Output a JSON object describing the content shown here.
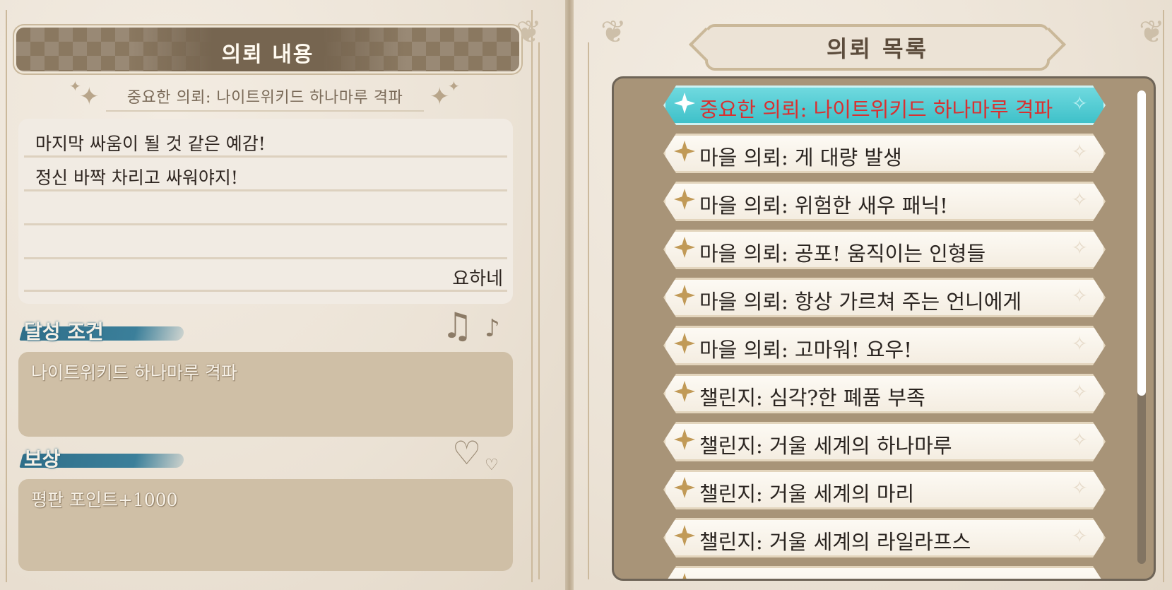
{
  "detail": {
    "title": "의뢰 내용",
    "quest_name": "중요한 의뢰: 나이트위키드 하나마루 격파",
    "message_lines": [
      "마지막 싸움이 될 것 같은 예감!",
      "정신 바짝 차리고 싸워야지!"
    ],
    "sender": "요하네",
    "condition_label": "달성 조건",
    "condition_text": "나이트위키드 하나마루 격파",
    "reward_label": "보상",
    "reward_text": "평판 포인트+1000"
  },
  "list": {
    "title": "의뢰 목록",
    "items": [
      {
        "label": "중요한 의뢰: 나이트위키드 하나마루 격파",
        "selected": true
      },
      {
        "label": "마을 의뢰: 게 대량 발생",
        "selected": false
      },
      {
        "label": "마을 의뢰: 위험한 새우 패닉!",
        "selected": false
      },
      {
        "label": "마을 의뢰: 공포! 움직이는 인형들",
        "selected": false
      },
      {
        "label": "마을 의뢰: 항상 가르쳐 주는 언니에게",
        "selected": false
      },
      {
        "label": "마을 의뢰: 고마워! 요우!",
        "selected": false
      },
      {
        "label": "챌린지: 심각?한 폐품 부족",
        "selected": false
      },
      {
        "label": "챌린지: 거울 세계의 하나마루",
        "selected": false
      },
      {
        "label": "챌린지: 거울 세계의 마리",
        "selected": false
      },
      {
        "label": "챌린지: 거울 세계의 라일라프스",
        "selected": false
      }
    ]
  },
  "colors": {
    "accent_teal": "#3fc1c9",
    "selected_text": "#d93030",
    "brush_blue": "#2f6f8a",
    "star_gold": "#c19a57"
  },
  "icons": {
    "quest_marker": "four-point-star-icon",
    "music": "music-notes-icon",
    "hearts": "hearts-icon"
  }
}
